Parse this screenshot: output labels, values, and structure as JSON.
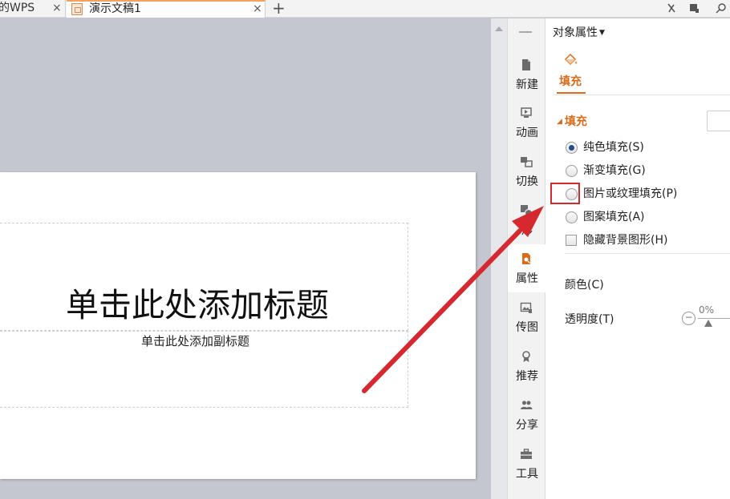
{
  "tabs": {
    "home_label": "的WPS",
    "doc_label": "演示文稿1",
    "close_glyph": "×",
    "add_glyph": "+"
  },
  "slide": {
    "title_placeholder": "单击此处添加标题",
    "subtitle_placeholder": "单击此处添加副标题"
  },
  "sidebar": {
    "items": [
      {
        "label": "新建"
      },
      {
        "label": "动画"
      },
      {
        "label": "切换"
      },
      {
        "label": "形"
      },
      {
        "label": "属性"
      },
      {
        "label": "传图"
      },
      {
        "label": "推荐"
      },
      {
        "label": "分享"
      },
      {
        "label": "工具"
      }
    ]
  },
  "pane": {
    "title": "对象属性",
    "tab_fill": "填充",
    "section_fill": "填充",
    "options": [
      {
        "label": "纯色填充(S)",
        "checked": true
      },
      {
        "label": "渐变填充(G)",
        "checked": false
      },
      {
        "label": "图片或纹理填充(P)",
        "checked": false
      },
      {
        "label": "图案填充(A)",
        "checked": false
      }
    ],
    "hide_bg_label": "隐藏背景图形(H)",
    "color_label": "颜色(C)",
    "transparency_label": "透明度(T)",
    "transparency_value": "0%"
  },
  "colors": {
    "accent": "#d96b1a",
    "annotation": "#d7282f"
  }
}
